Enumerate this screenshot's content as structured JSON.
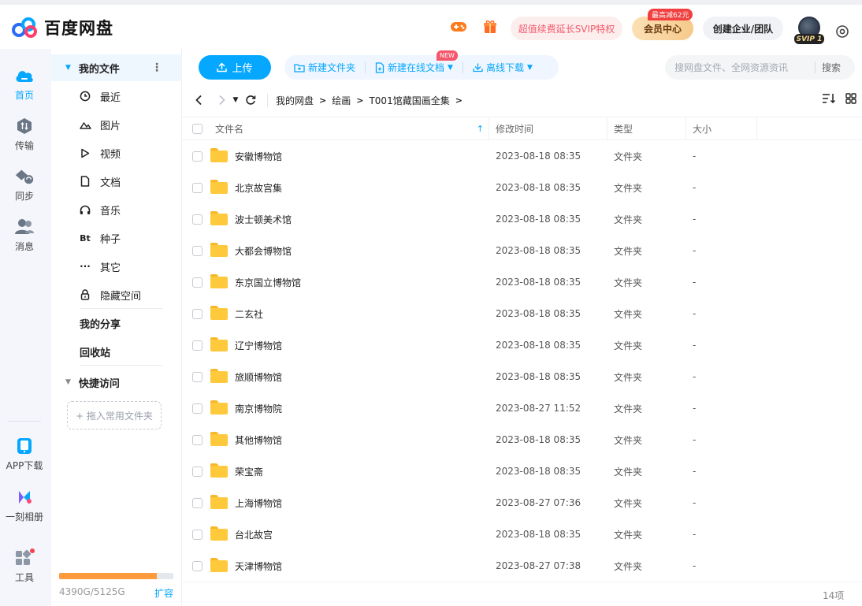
{
  "header": {
    "app_name": "百度网盘",
    "svip_promo": "超值续费延长SVIP特权",
    "vip_center": "会员中心",
    "vip_badge": "最高减62元",
    "enterprise": "创建企业/团队",
    "avatar_tag": "SVIP 1"
  },
  "rail": {
    "items": [
      {
        "label": "首页",
        "active": true
      },
      {
        "label": "传输"
      },
      {
        "label": "同步"
      },
      {
        "label": "消息"
      },
      {
        "label": "APP下载"
      },
      {
        "label": "一刻相册"
      },
      {
        "label": "工具"
      }
    ]
  },
  "sidebar": {
    "my_files": "我的文件",
    "categories": [
      "最近",
      "图片",
      "视频",
      "文档",
      "音乐",
      "种子",
      "其它",
      "隐藏空间"
    ],
    "seed_icon_text": "Bt",
    "other_icon_text": "···",
    "my_share": "我的分享",
    "recycle": "回收站",
    "quick_access": "快捷访问",
    "drag_folder": "+ 拖入常用文件夹",
    "storage_text": "4390G/5125G",
    "storage_used_fraction": 0.857,
    "expand": "扩容"
  },
  "toolbar": {
    "upload": "上传",
    "new_folder": "新建文件夹",
    "new_online_doc": "新建在线文档",
    "new_badge": "NEW",
    "offline_download": "离线下载",
    "search_placeholder": "搜网盘文件、全网资源资讯",
    "search_button": "搜索"
  },
  "breadcrumb": [
    "我的网盘",
    "绘画",
    "T001馆藏国画全集"
  ],
  "table": {
    "headers": {
      "name": "文件名",
      "modified": "修改时间",
      "type": "类型",
      "size": "大小"
    },
    "rows": [
      {
        "name": "安徽博物馆",
        "modified": "2023-08-18 08:35",
        "type": "文件夹",
        "size": "-"
      },
      {
        "name": "北京故宫集",
        "modified": "2023-08-18 08:35",
        "type": "文件夹",
        "size": "-"
      },
      {
        "name": "波士顿美术馆",
        "modified": "2023-08-18 08:35",
        "type": "文件夹",
        "size": "-"
      },
      {
        "name": "大都会博物馆",
        "modified": "2023-08-18 08:35",
        "type": "文件夹",
        "size": "-"
      },
      {
        "name": "东京国立博物馆",
        "modified": "2023-08-18 08:35",
        "type": "文件夹",
        "size": "-"
      },
      {
        "name": "二玄社",
        "modified": "2023-08-18 08:35",
        "type": "文件夹",
        "size": "-"
      },
      {
        "name": "辽宁博物馆",
        "modified": "2023-08-18 08:35",
        "type": "文件夹",
        "size": "-"
      },
      {
        "name": "旅顺博物馆",
        "modified": "2023-08-18 08:35",
        "type": "文件夹",
        "size": "-"
      },
      {
        "name": "南京博物院",
        "modified": "2023-08-27 11:52",
        "type": "文件夹",
        "size": "-"
      },
      {
        "name": "其他博物馆",
        "modified": "2023-08-18 08:35",
        "type": "文件夹",
        "size": "-"
      },
      {
        "name": "荣宝斋",
        "modified": "2023-08-18 08:35",
        "type": "文件夹",
        "size": "-"
      },
      {
        "name": "上海博物馆",
        "modified": "2023-08-27 07:36",
        "type": "文件夹",
        "size": "-"
      },
      {
        "name": "台北故宫",
        "modified": "2023-08-18 08:35",
        "type": "文件夹",
        "size": "-"
      },
      {
        "name": "天津博物馆",
        "modified": "2023-08-27 07:38",
        "type": "文件夹",
        "size": "-"
      }
    ],
    "item_count": "14项"
  },
  "colors": {
    "accent": "#06a7ff",
    "storage": "#ff9a3d",
    "folder": "#ffc93c",
    "promo": "#f25a6c"
  },
  "icons": {
    "rail": [
      "cloud-home-icon",
      "transfer-icon",
      "sync-icon",
      "message-icon",
      "app-download-icon",
      "moment-album-icon",
      "tools-icon"
    ],
    "sidebar": [
      "clock-icon",
      "image-icon",
      "video-icon",
      "document-icon",
      "headphones-icon",
      "torrent-icon",
      "more-icon",
      "lock-icon"
    ]
  }
}
